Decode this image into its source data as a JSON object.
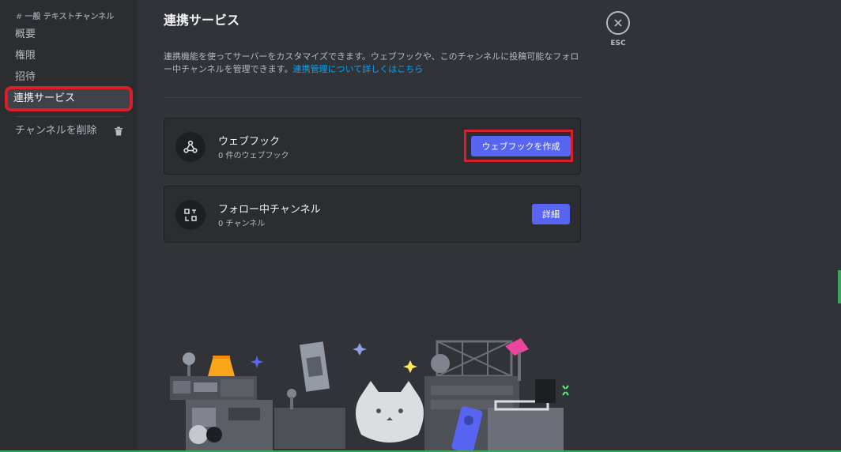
{
  "sidebar": {
    "header_hash": "#",
    "header": "一般 テキストチャンネル",
    "items": [
      {
        "label": "概要"
      },
      {
        "label": "権限"
      },
      {
        "label": "招待"
      },
      {
        "label": "連携サービス"
      }
    ],
    "delete_label": "チャンネルを削除"
  },
  "main": {
    "title": "連携サービス",
    "description": "連携機能を使ってサーバーをカスタマイズできます。ウェブフックや、このチャンネルに投稿可能なフォロー中チャンネルを管理できます。",
    "link_text": "連携管理について詳しくはこちら",
    "webhook": {
      "title": "ウェブフック",
      "subtitle": "0 件のウェブフック",
      "button_label": "ウェブフックを作成"
    },
    "followed": {
      "title": "フォロー中チャンネル",
      "subtitle": "0 チャンネル",
      "button_label": "詳細"
    }
  },
  "esc": {
    "label": "ESC"
  },
  "colors": {
    "accent": "#5865f2",
    "link": "#00a8fc",
    "highlight": "#d81f2a",
    "background": "#313338",
    "sidebar": "#2b2d31"
  }
}
